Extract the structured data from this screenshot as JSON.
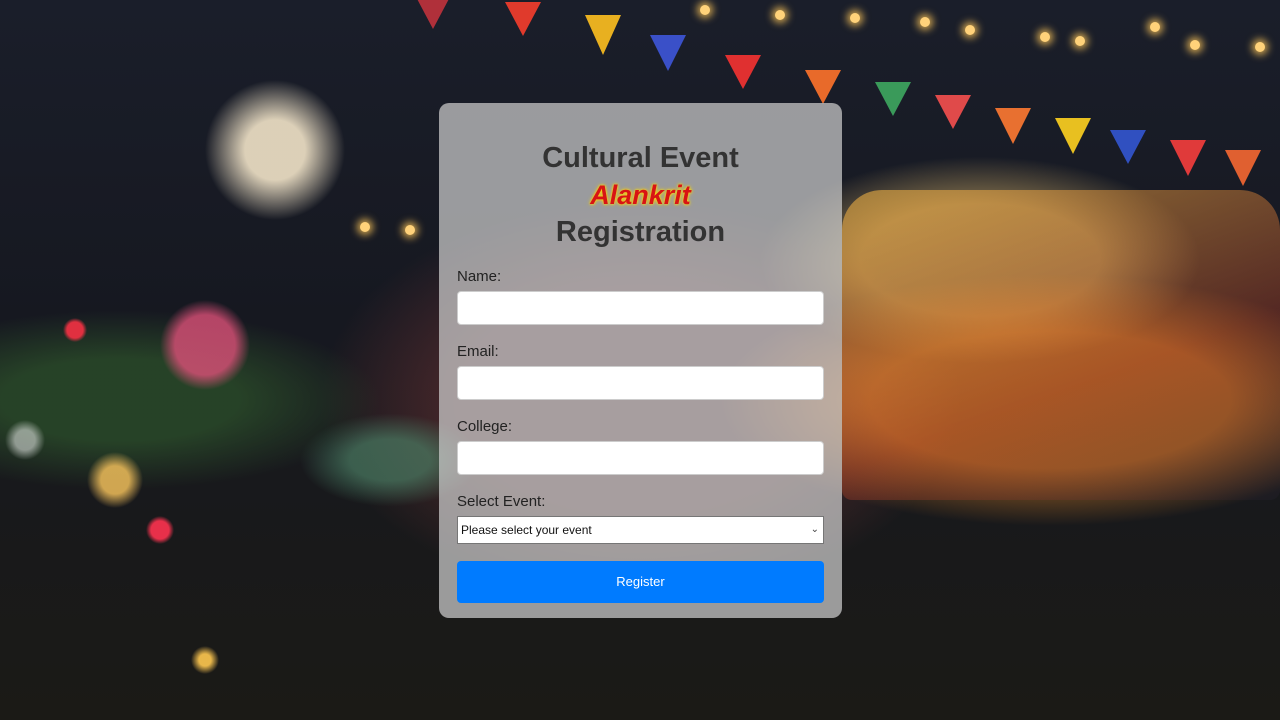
{
  "colors": {
    "accent": "#007bff",
    "brand_text": "#d81414",
    "brand_glow": "#ffe000",
    "title_text": "#333333",
    "card_bg": "rgba(205,205,205,0.72)"
  },
  "form": {
    "title_line1": "Cultural Event",
    "brand_name": "Alankrit",
    "title_line2": "Registration",
    "name_label": "Name:",
    "name_value": "",
    "email_label": "Email:",
    "email_value": "",
    "college_label": "College:",
    "college_value": "",
    "event_label": "Select Event:",
    "event_selected": "Please select your event",
    "register_label": "Register"
  },
  "icons": {
    "select_arrow": "chevron-down-icon"
  }
}
